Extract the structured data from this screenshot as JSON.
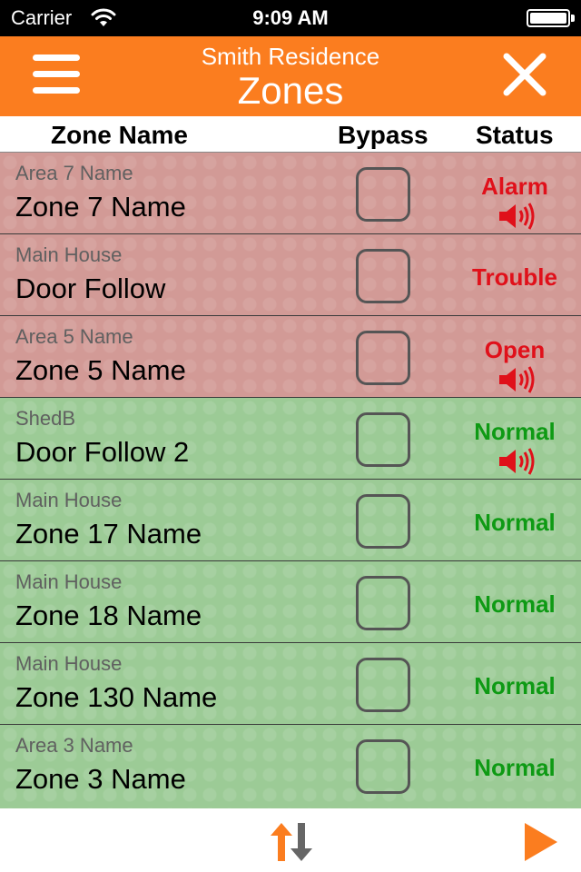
{
  "status_bar": {
    "carrier": "Carrier",
    "time": "9:09 AM"
  },
  "header": {
    "subtitle": "Smith Residence",
    "title": "Zones"
  },
  "columns": {
    "name": "Zone Name",
    "bypass": "Bypass",
    "status": "Status"
  },
  "colors": {
    "accent": "#fb7d1f",
    "alarm_red": "#e0101a",
    "normal_green": "#0e9a14",
    "row_red": "#d29a96",
    "row_green": "#9ccb96"
  },
  "zones": [
    {
      "area": "Area 7 Name",
      "name": "Zone 7 Name",
      "status": "Alarm",
      "row_state": "red",
      "status_color": "alarm",
      "speaker": true,
      "bypassed": false
    },
    {
      "area": "Main House",
      "name": "Door Follow",
      "status": "Trouble",
      "row_state": "red",
      "status_color": "alarm",
      "speaker": false,
      "bypassed": false
    },
    {
      "area": "Area 5 Name",
      "name": "Zone 5 Name",
      "status": "Open",
      "row_state": "red",
      "status_color": "alarm",
      "speaker": true,
      "bypassed": false
    },
    {
      "area": "ShedB",
      "name": "Door Follow 2",
      "status": "Normal",
      "row_state": "green",
      "status_color": "normal",
      "speaker": true,
      "bypassed": false
    },
    {
      "area": "Main House",
      "name": "Zone 17 Name",
      "status": "Normal",
      "row_state": "green",
      "status_color": "normal",
      "speaker": false,
      "bypassed": false
    },
    {
      "area": "Main House",
      "name": "Zone 18 Name",
      "status": "Normal",
      "row_state": "green",
      "status_color": "normal",
      "speaker": false,
      "bypassed": false
    },
    {
      "area": "Main House",
      "name": "Zone 130 Name",
      "status": "Normal",
      "row_state": "green",
      "status_color": "normal",
      "speaker": false,
      "bypassed": false
    },
    {
      "area": "Area 3 Name",
      "name": "Zone 3 Name",
      "status": "Normal",
      "row_state": "green",
      "status_color": "normal",
      "speaker": false,
      "bypassed": false
    }
  ],
  "icons": {
    "menu": "hamburger-icon",
    "close": "close-icon",
    "sort": "sort-icon",
    "play": "play-icon",
    "speaker": "speaker-icon",
    "wifi": "wifi-icon",
    "battery": "battery-icon"
  }
}
